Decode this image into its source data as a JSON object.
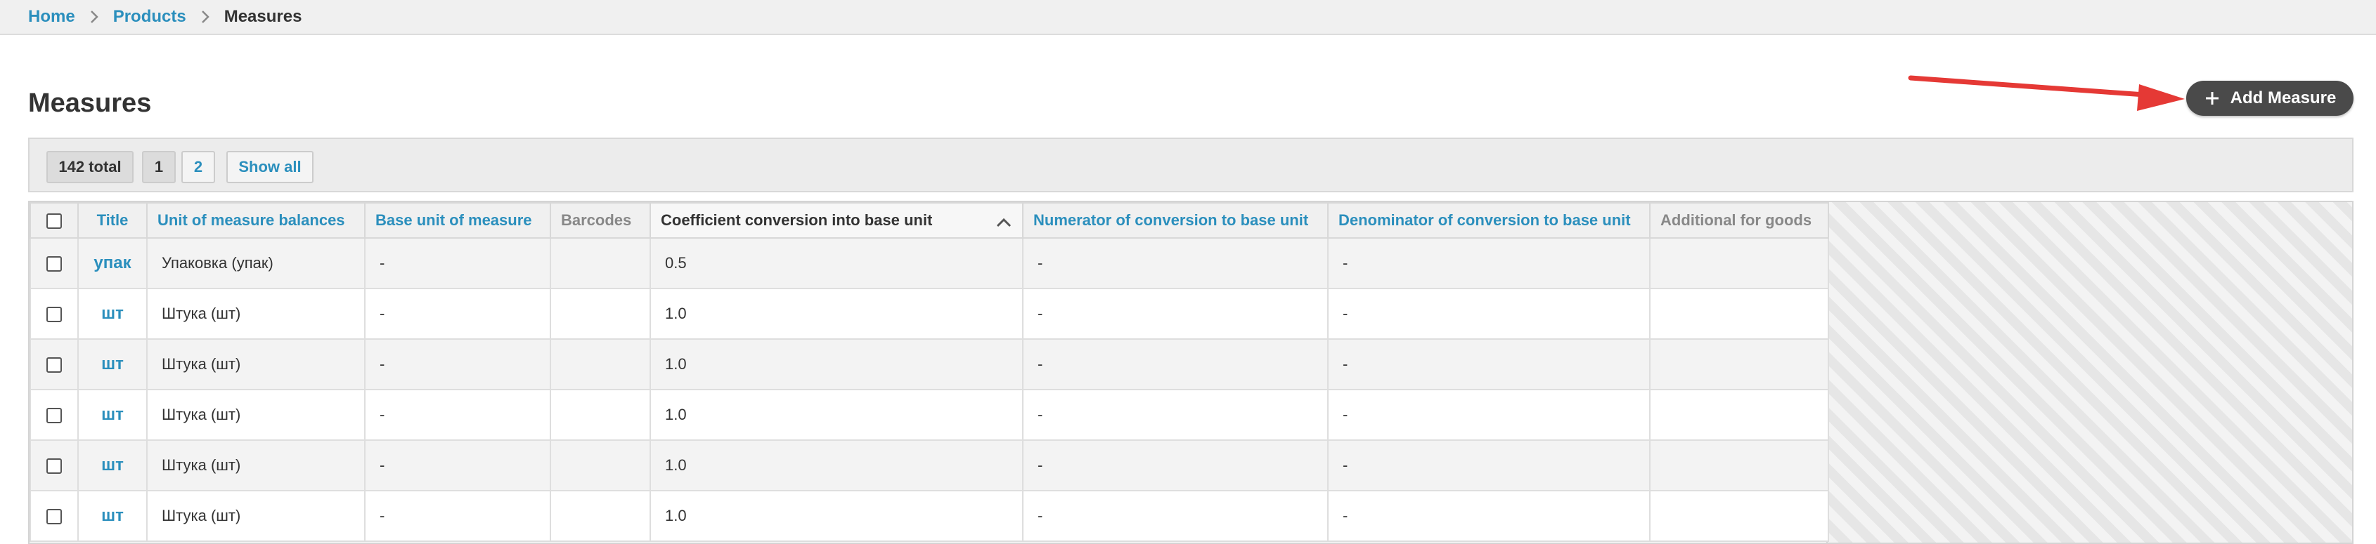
{
  "breadcrumb": {
    "items": [
      {
        "label": "Home"
      },
      {
        "label": "Products"
      },
      {
        "label": "Measures"
      }
    ]
  },
  "page_title": "Measures",
  "add_button": {
    "label": "Add Measure",
    "icon": "plus-icon"
  },
  "pagination": {
    "total": "142 total",
    "pages": [
      "1",
      "2"
    ],
    "show_all": "Show all"
  },
  "table": {
    "columns": [
      "Title",
      "Unit of measure balances",
      "Base unit of measure",
      "Barcodes",
      "Coefficient conversion into base unit",
      "Numerator of conversion to base unit",
      "Denominator of conversion to base unit",
      "Additional for goods"
    ],
    "rows": [
      {
        "title": "упак",
        "unit": "Упаковка (упак)",
        "base": "-",
        "barcodes": "",
        "coef": "0.5",
        "num": "-",
        "den": "-",
        "additional": ""
      },
      {
        "title": "шт",
        "unit": "Штука (шт)",
        "base": "-",
        "barcodes": "",
        "coef": "1.0",
        "num": "-",
        "den": "-",
        "additional": ""
      },
      {
        "title": "шт",
        "unit": "Штука (шт)",
        "base": "-",
        "barcodes": "",
        "coef": "1.0",
        "num": "-",
        "den": "-",
        "additional": ""
      },
      {
        "title": "шт",
        "unit": "Штука (шт)",
        "base": "-",
        "barcodes": "",
        "coef": "1.0",
        "num": "-",
        "den": "-",
        "additional": ""
      },
      {
        "title": "шт",
        "unit": "Штука (шт)",
        "base": "-",
        "barcodes": "",
        "coef": "1.0",
        "num": "-",
        "den": "-",
        "additional": ""
      },
      {
        "title": "шт",
        "unit": "Штука (шт)",
        "base": "-",
        "barcodes": "",
        "coef": "1.0",
        "num": "-",
        "den": "-",
        "additional": ""
      }
    ]
  },
  "colors": {
    "link": "#2b8fbd",
    "button_bg": "#4a4a4a",
    "arrow": "#e53935"
  }
}
